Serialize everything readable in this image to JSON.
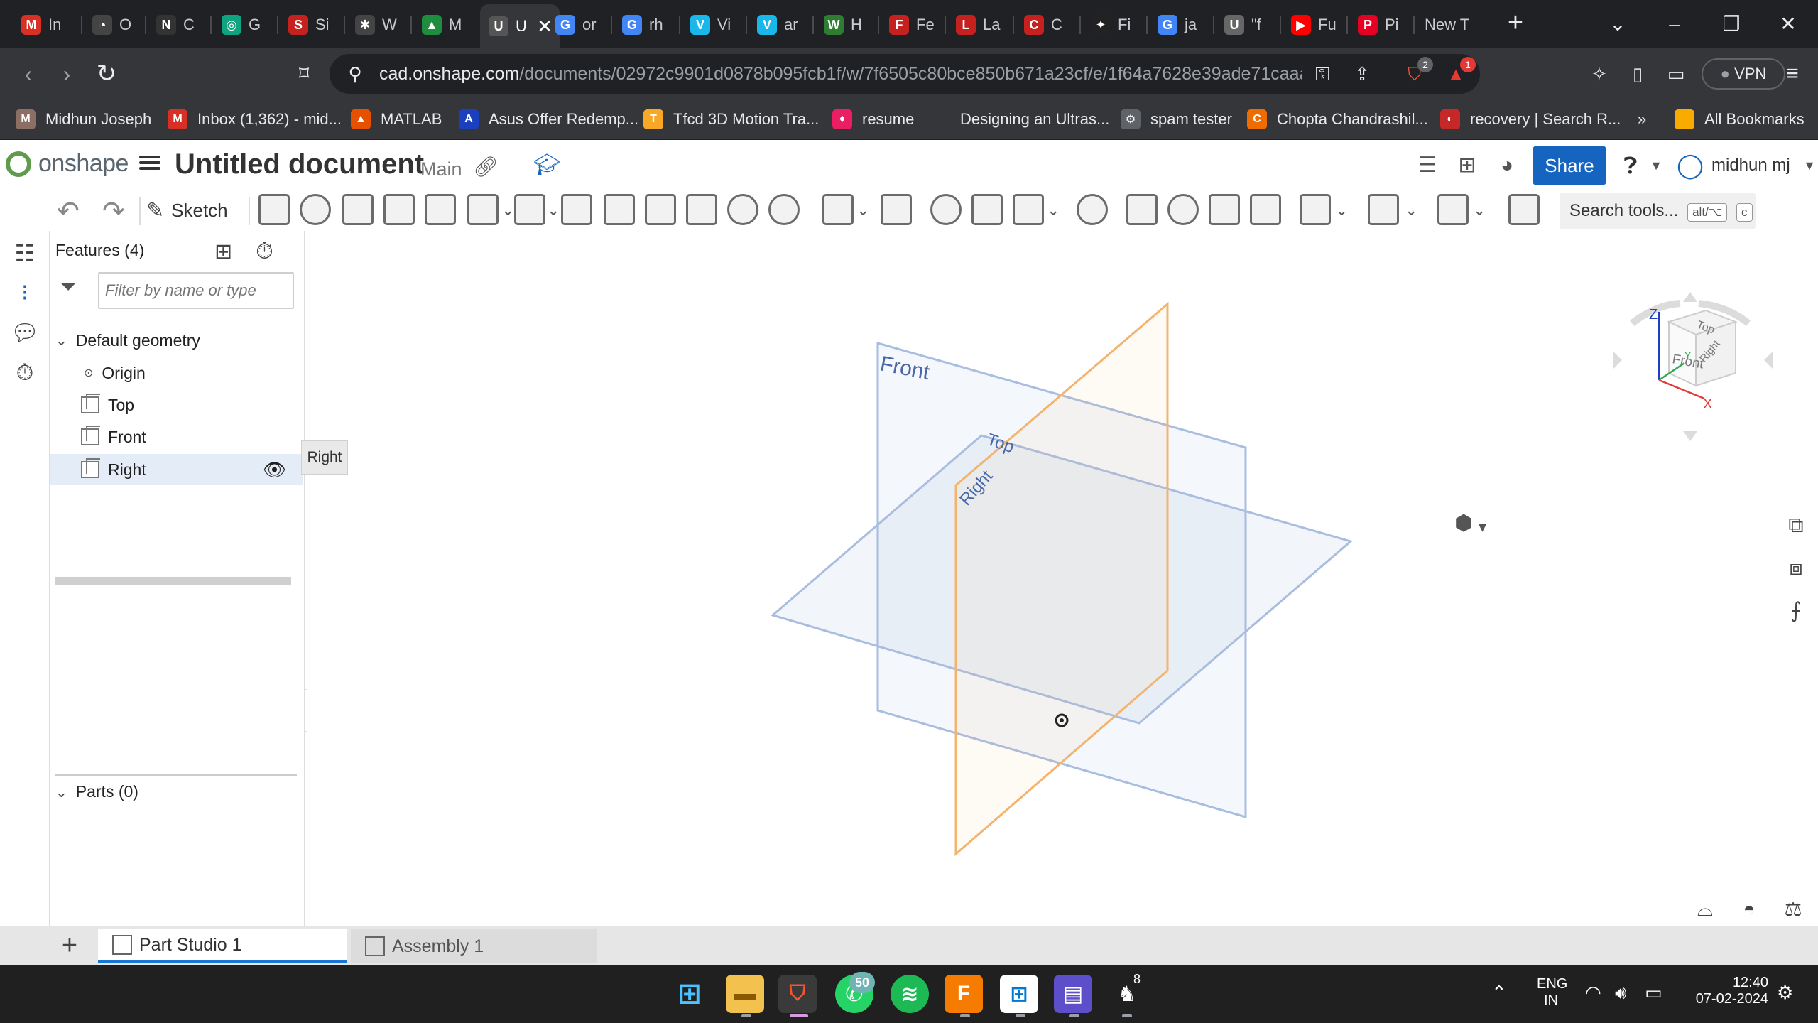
{
  "browser": {
    "tabs": [
      {
        "label": "In",
        "fav": "gmail-icon",
        "color": "#d93025",
        "glyph": "M"
      },
      {
        "label": "O",
        "fav": "circle-logo-icon",
        "color": "#444",
        "glyph": "◔"
      },
      {
        "label": "C",
        "fav": "notion-icon",
        "color": "#333",
        "glyph": "N"
      },
      {
        "label": "G",
        "fav": "chatgpt-icon",
        "color": "#10a37f",
        "glyph": "◎"
      },
      {
        "label": "Si",
        "fav": "sheet-icon",
        "color": "#c5221f",
        "glyph": "S"
      },
      {
        "label": "W",
        "fav": "star-icon",
        "color": "#444",
        "glyph": "✱"
      },
      {
        "label": "M",
        "fav": "mountain-icon",
        "color": "#1e8e3e",
        "glyph": "▲"
      },
      {
        "label": "U",
        "fav": "onshape-icon",
        "color": "#555",
        "glyph": "U"
      },
      {
        "label": "or",
        "fav": "google-icon",
        "color": "#4285f4",
        "glyph": "G"
      },
      {
        "label": "rh",
        "fav": "google-icon",
        "color": "#4285f4",
        "glyph": "G"
      },
      {
        "label": "Vi",
        "fav": "vimeo-icon",
        "color": "#1ab7ea",
        "glyph": "V"
      },
      {
        "label": "ar",
        "fav": "vimeo-icon",
        "color": "#1ab7ea",
        "glyph": "V"
      },
      {
        "label": "H",
        "fav": "w-icon",
        "color": "#2e7d32",
        "glyph": "W"
      },
      {
        "label": "Fe",
        "fav": "sheet-icon",
        "color": "#c5221f",
        "glyph": "F"
      },
      {
        "label": "La",
        "fav": "sheet-icon",
        "color": "#c5221f",
        "glyph": "L"
      },
      {
        "label": "C",
        "fav": "sheet-icon",
        "color": "#c5221f",
        "glyph": "C"
      },
      {
        "label": "Fi",
        "fav": "figma-icon",
        "color": "#222",
        "glyph": "✦"
      },
      {
        "label": "ja",
        "fav": "google-icon",
        "color": "#4285f4",
        "glyph": "G"
      },
      {
        "label": "\"f",
        "fav": "u-icon",
        "color": "#666",
        "glyph": "U"
      },
      {
        "label": "Fu",
        "fav": "youtube-icon",
        "color": "#ff0000",
        "glyph": "▶"
      },
      {
        "label": "Pi",
        "fav": "pinterest-icon",
        "color": "#e60023",
        "glyph": "P"
      },
      {
        "label": "New T",
        "fav": "",
        "color": "",
        "glyph": ""
      }
    ],
    "active_tab_index": 7,
    "active_tab_close": "✕",
    "url_domain": "cad.onshape.com",
    "url_path": "/documents/02972c9901d0878b095fcb1f/w/7f6505c80bce850b671a23cf/e/1f64a7628e39ade71caaa...",
    "vpn_label": "VPN",
    "brave_badge": "2",
    "alert_badge": "1",
    "bookmarks": [
      {
        "label": "Midhun Joseph",
        "color": "#8d6e63",
        "glyph": "M"
      },
      {
        "label": "Inbox (1,362) - mid...",
        "color": "#d93025",
        "glyph": "M"
      },
      {
        "label": "MATLAB",
        "color": "#e65100",
        "glyph": "▲"
      },
      {
        "label": "Asus Offer Redemp...",
        "color": "#1a3fbf",
        "glyph": "A"
      },
      {
        "label": "Tfcd 3D Motion Tra...",
        "color": "#f9a825",
        "glyph": "T"
      },
      {
        "label": "resume",
        "color": "#e91e63",
        "glyph": "♦"
      },
      {
        "label": "Designing an Ultras...",
        "color": "",
        "glyph": ""
      },
      {
        "label": "spam tester",
        "color": "#5f6368",
        "glyph": "⚙"
      },
      {
        "label": "Chopta Chandrashil...",
        "color": "#ef6c00",
        "glyph": "C"
      },
      {
        "label": "recovery | Search R...",
        "color": "#c62828",
        "glyph": "◐"
      }
    ],
    "bookmarks_more": "»",
    "all_bookmarks": "All Bookmarks"
  },
  "app": {
    "logo_text": "onshape",
    "doc_title": "Untitled document",
    "branch": "Main",
    "share_label": "Share",
    "user_name": "midhun mj",
    "sketch_label": "Sketch",
    "search_tools": "Search tools...",
    "search_kbd_1": "alt/⌥",
    "search_kbd_2": "c",
    "features_title": "Features (4)",
    "filter_placeholder": "Filter by name or type",
    "tree": {
      "group": "Default geometry",
      "items": [
        "Origin",
        "Top",
        "Front",
        "Right"
      ]
    },
    "tooltip": "Right",
    "parts_title": "Parts (0)",
    "viewport": {
      "plane_labels": {
        "front": "Front",
        "top": "Top",
        "right": "Right"
      },
      "viewcube": {
        "top": "Top",
        "front": "Front",
        "right": "Right",
        "x": "X",
        "y": "Y",
        "z": "Z"
      }
    },
    "tabs": [
      {
        "label": "Part Studio 1",
        "active": true
      },
      {
        "label": "Assembly 1",
        "active": false
      }
    ],
    "colors": {
      "accent": "#1565c0",
      "plane": "#6d8fc7",
      "selected_plane": "#f0a24a"
    }
  },
  "taskbar": {
    "whatsapp_badge": "50",
    "app8_badge": "8",
    "lang_1": "ENG",
    "lang_2": "IN",
    "time": "12:40",
    "date": "07-02-2024"
  }
}
